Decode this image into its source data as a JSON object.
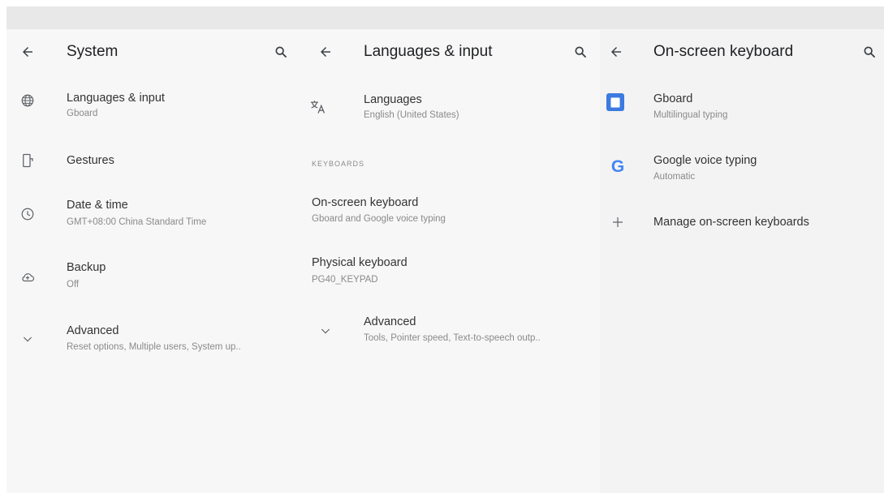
{
  "panes": {
    "system": {
      "title": "System",
      "items": [
        {
          "icon": "globe-icon",
          "title": "Languages & input",
          "summary": "Gboard"
        },
        {
          "icon": "gestures-icon",
          "title": "Gestures",
          "summary": ""
        },
        {
          "icon": "clock-icon",
          "title": "Date & time",
          "summary": "GMT+08:00 China Standard Time"
        },
        {
          "icon": "backup-icon",
          "title": "Backup",
          "summary": "Off"
        },
        {
          "icon": "chevron-down-icon",
          "title": "Advanced",
          "summary": "Reset options, Multiple users, System up.."
        }
      ]
    },
    "languages_input": {
      "title": "Languages & input",
      "languages": {
        "icon": "translate-icon",
        "title": "Languages",
        "summary": "English (United States)"
      },
      "category": "KEYBOARDS",
      "on_screen_keyboard": {
        "title": "On-screen keyboard",
        "summary": "Gboard and Google voice typing"
      },
      "physical_keyboard": {
        "title": "Physical keyboard",
        "summary": "PG40_KEYPAD"
      },
      "advanced": {
        "icon": "chevron-down-icon",
        "title": "Advanced",
        "summary": "Tools, Pointer speed, Text-to-speech outp.."
      }
    },
    "on_screen_keyboard": {
      "title": "On-screen keyboard",
      "items": [
        {
          "icon": "gboard-icon",
          "title": "Gboard",
          "summary": "Multilingual typing"
        },
        {
          "icon": "google-icon",
          "title": "Google voice typing",
          "summary": "Automatic"
        },
        {
          "icon": "plus-icon",
          "title": "Manage on-screen keyboards",
          "summary": ""
        }
      ]
    }
  },
  "glyphs": {
    "google_g": "G"
  },
  "colors": {
    "pane_bg": "#f7f7f7",
    "pane3_bg": "#f3f3f3",
    "statusbar": "#e8e8e8",
    "icon": "#5f6368",
    "gboard_blue": "#3b7ae0"
  }
}
